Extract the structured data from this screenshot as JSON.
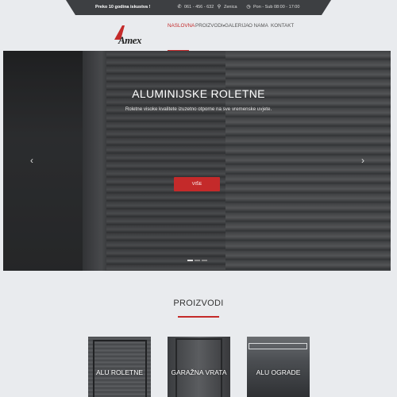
{
  "topbar": {
    "tagline": "Preko 10 godina iskustva !",
    "phone": "061 - 456 - 632",
    "location": "Zenica",
    "hours": "Pon - Sub 08:00 - 17:00",
    "phone_icon": "phone-icon",
    "location_icon": "map-pin-icon",
    "hours_icon": "clock-icon"
  },
  "logo": {
    "text": "Amex"
  },
  "nav": {
    "items": [
      {
        "label": "NASLOVNA"
      },
      {
        "label": "PROIZVODI"
      },
      {
        "label": "GALERIJA"
      },
      {
        "label": "O NAMA"
      },
      {
        "label": "KONTAKT"
      }
    ],
    "dropdown_icon": "caret-down-icon"
  },
  "hero": {
    "title": "ALUMINIJSKE ROLETNE",
    "subtitle": "Roletne visoke kvalitete izuzetno otporne na sve vremenske uvjete.",
    "button": "VIŠE",
    "prev": "‹",
    "next": "›",
    "slides": 3,
    "active_slide": 1
  },
  "products": {
    "title": "PROIZVODI",
    "cards": [
      {
        "label": "ALU ROLETNE"
      },
      {
        "label": "GARAŽNA VRATA"
      },
      {
        "label": "ALU OGRADE"
      }
    ]
  },
  "colors": {
    "accent": "#c42a2a",
    "topbar": "#3d3f42",
    "background": "#e9ebee"
  }
}
